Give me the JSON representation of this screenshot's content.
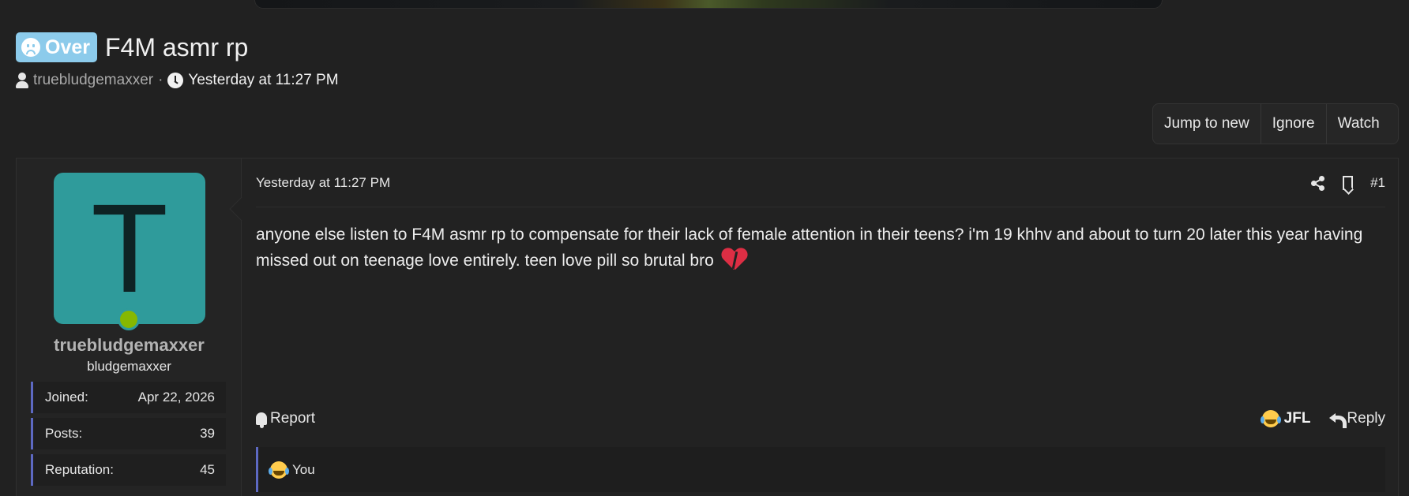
{
  "thread": {
    "prefix": "Over",
    "title": "F4M asmr rp",
    "author": "truebludgemaxxer",
    "separator": "·",
    "date": "Yesterday at 11:27 PM"
  },
  "thread_actions": {
    "jump_to_new": "Jump to new",
    "ignore": "Ignore",
    "watch": "Watch"
  },
  "post": {
    "user": {
      "avatar_letter": "T",
      "avatar_color": "#2f9b9b",
      "online_color": "#86b800",
      "username": "truebludgemaxxer",
      "user_title": "bludgemaxxer",
      "stats": [
        {
          "label": "Joined:",
          "value": "Apr 22, 2026"
        },
        {
          "label": "Posts:",
          "value": "39"
        },
        {
          "label": "Reputation:",
          "value": "45"
        }
      ]
    },
    "date": "Yesterday at 11:27 PM",
    "number": "#1",
    "body": "anyone else listen to F4M asmr rp to compensate for their lack of female attention in their teens? i'm 19 khhv and about to turn 20 later this year having missed out on teenage love entirely. teen love pill so brutal bro",
    "body_emoji": "broken-heart-icon",
    "report_label": "Report",
    "reaction_label": "JFL",
    "reply_label": "Reply",
    "reaction_summary": "You"
  },
  "colors": {
    "background": "#212121",
    "prefix_bg": "#8ccbeb",
    "accent_border": "#5d69c2"
  }
}
